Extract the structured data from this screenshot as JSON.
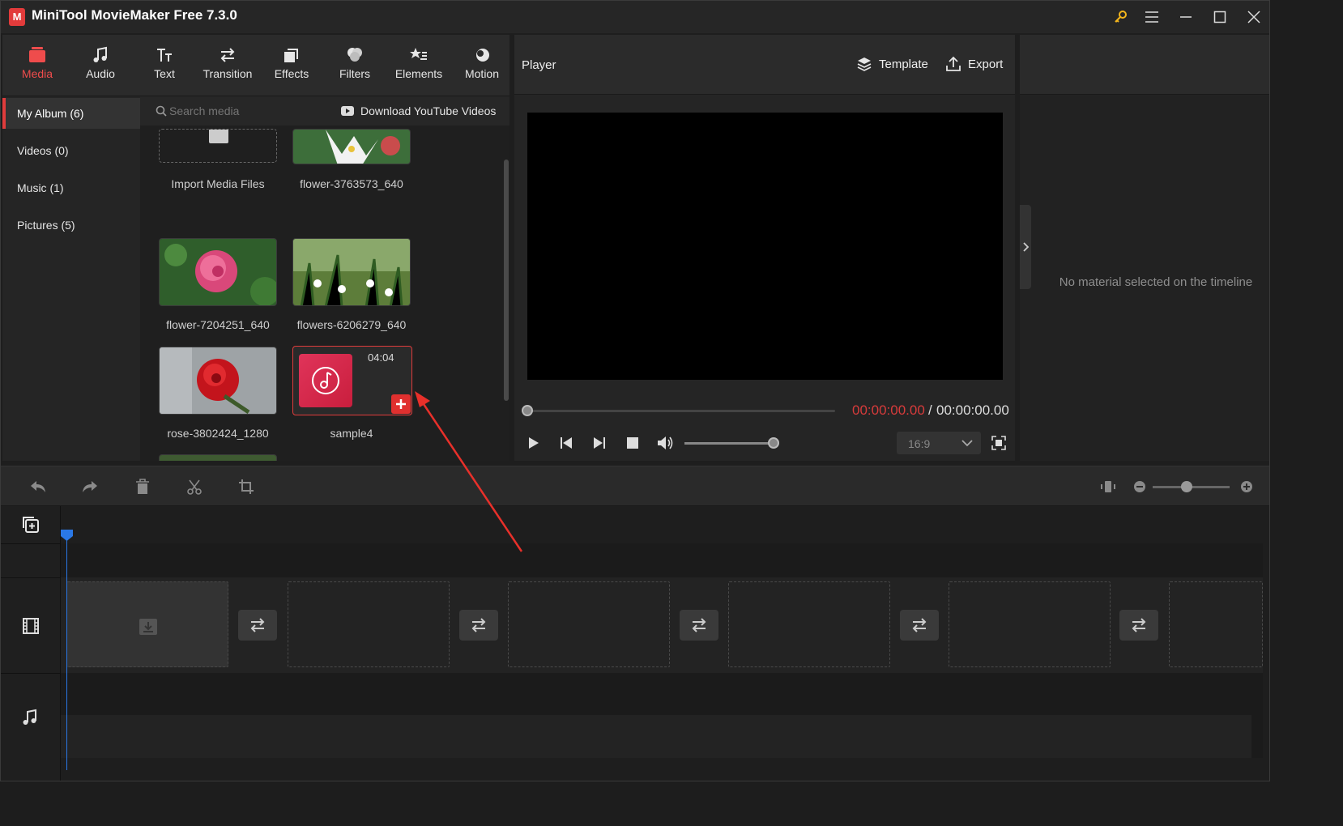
{
  "app": {
    "title": "MiniTool MovieMaker Free 7.3.0",
    "logo_text": "M"
  },
  "colors": {
    "accent": "#e03c3c",
    "time_red": "#d73b3b",
    "playhead": "#2a78e6"
  },
  "nav_tabs": [
    {
      "label": "Media",
      "icon": "media-icon",
      "active": true
    },
    {
      "label": "Audio",
      "icon": "music-note-icon"
    },
    {
      "label": "Text",
      "icon": "text-icon"
    },
    {
      "label": "Transition",
      "icon": "transition-icon"
    },
    {
      "label": "Effects",
      "icon": "effects-icon"
    },
    {
      "label": "Filters",
      "icon": "filters-icon"
    },
    {
      "label": "Elements",
      "icon": "elements-icon"
    },
    {
      "label": "Motion",
      "icon": "motion-icon"
    }
  ],
  "sidebar": {
    "items": [
      {
        "label": "My Album (6)",
        "active": true
      },
      {
        "label": "Videos (0)"
      },
      {
        "label": "Music (1)"
      },
      {
        "label": "Pictures (5)"
      }
    ]
  },
  "media": {
    "search_placeholder": "Search media",
    "youtube_label": "Download YouTube Videos",
    "items": [
      {
        "caption": "Import Media Files",
        "kind": "import"
      },
      {
        "caption": "flower-3763573_640",
        "kind": "image"
      },
      {
        "caption": "flower-7204251_640",
        "kind": "image"
      },
      {
        "caption": "flowers-6206279_640",
        "kind": "image"
      },
      {
        "caption": "rose-3802424_1280",
        "kind": "image"
      },
      {
        "caption": "sample4",
        "kind": "audio",
        "duration": "04:04",
        "selected": true
      },
      {
        "caption": "",
        "kind": "image"
      }
    ]
  },
  "player": {
    "title": "Player",
    "template_label": "Template",
    "export_label": "Export",
    "time_current": "00:00:00.00",
    "time_separator": "/",
    "time_total": "00:00:00.00",
    "aspect_ratio": "16:9"
  },
  "properties": {
    "empty_text": "No material selected on the timeline"
  }
}
